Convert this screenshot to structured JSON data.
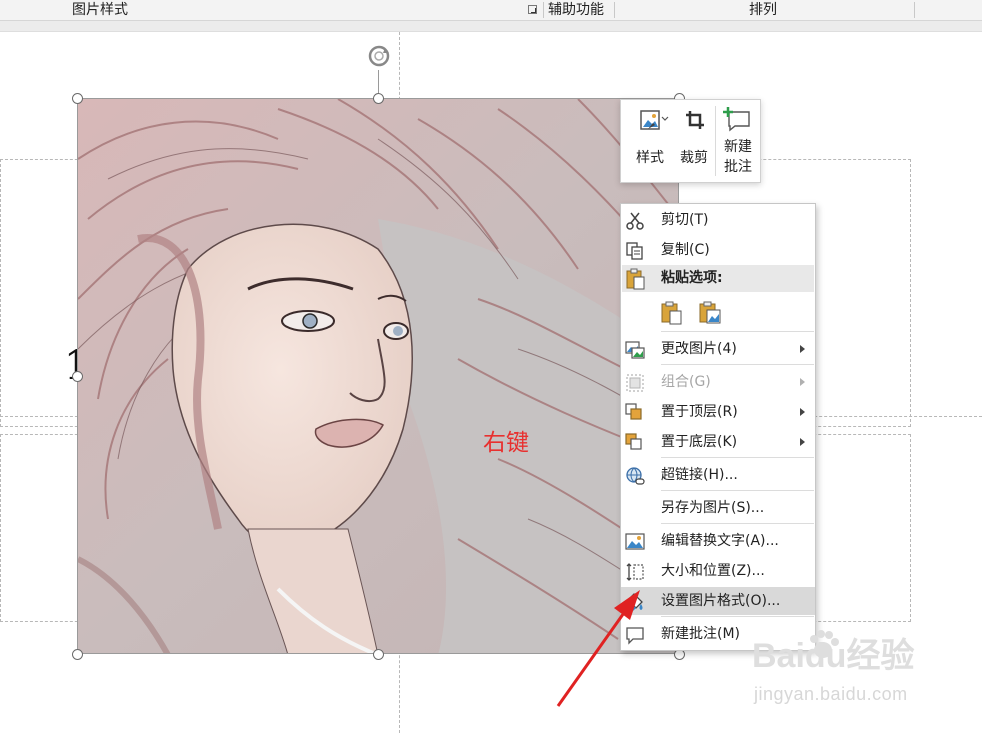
{
  "ribbon": {
    "group_picture_styles": "图片样式",
    "group_accessibility": "辅助功能",
    "group_arrange": "排列"
  },
  "annotation": {
    "text": "右键",
    "color": "#e8302f"
  },
  "mini_toolbar": {
    "style_label": "样式",
    "crop_label": "裁剪",
    "new_comment_line1": "新建",
    "new_comment_line2": "批注"
  },
  "context_menu": {
    "items": [
      {
        "label": "剪切(T)",
        "icon": "scissors-icon"
      },
      {
        "label": "复制(C)",
        "icon": "copy-icon"
      },
      {
        "label": "粘贴选项:",
        "icon": "clipboard-icon"
      },
      {
        "label": "更改图片(4)",
        "icon": "change-picture-icon",
        "submenu": true
      },
      {
        "label": "组合(G)",
        "icon": "group-icon",
        "submenu": true,
        "disabled": true
      },
      {
        "label": "置于顶层(R)",
        "icon": "bring-to-front-icon",
        "submenu": true
      },
      {
        "label": "置于底层(K)",
        "icon": "send-to-back-icon",
        "submenu": true
      },
      {
        "label": "超链接(H)...",
        "icon": "hyperlink-icon"
      },
      {
        "label": "另存为图片(S)...",
        "icon": ""
      },
      {
        "label": "编辑替换文字(A)...",
        "icon": "alt-text-icon"
      },
      {
        "label": "大小和位置(Z)...",
        "icon": "size-position-icon"
      },
      {
        "label": "设置图片格式(O)...",
        "icon": "format-picture-icon",
        "highlighted": true
      },
      {
        "label": "新建批注(M)",
        "icon": "comment-icon"
      }
    ],
    "paste_options": [
      "paste-keep-format-icon",
      "paste-as-picture-icon"
    ]
  },
  "watermark": {
    "brand": "Baidu经验",
    "url": "jingyan.baidu.com"
  },
  "colors": {
    "highlight": "#d9d9d9",
    "annotation_red": "#e8302f",
    "arrow_red": "#e02222",
    "selection_border": "#9a9a9a"
  }
}
